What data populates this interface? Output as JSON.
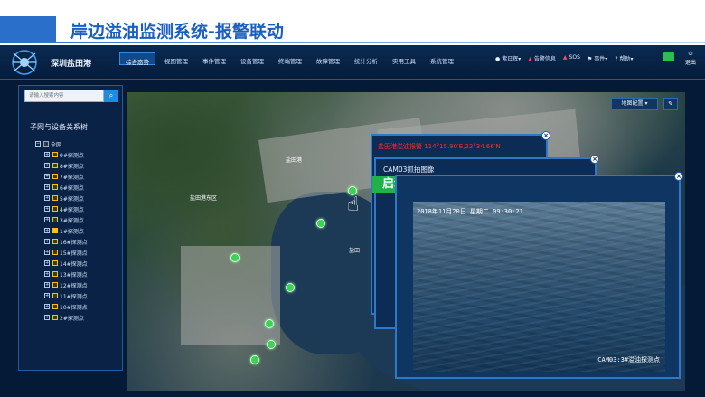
{
  "slide": {
    "title": "岸边溢油监测系统-报警联动"
  },
  "app": {
    "brand": "深圳盐田港",
    "nav_tabs": [
      {
        "label": "综合态势",
        "active": true
      },
      {
        "label": "视图管理",
        "active": false
      },
      {
        "label": "事件管理",
        "active": false
      },
      {
        "label": "设备管理",
        "active": false
      },
      {
        "label": "终端管理",
        "active": false
      },
      {
        "label": "故障管理",
        "active": false
      },
      {
        "label": "统计分析",
        "active": false
      },
      {
        "label": "实用工具",
        "active": false
      },
      {
        "label": "系统管理",
        "active": false
      }
    ],
    "right_tools": {
      "user": "紫日辉",
      "alerts": "告警信息",
      "sos": "SOS",
      "events": "事件",
      "help": "帮助",
      "exit": "退出"
    }
  },
  "sidebar": {
    "search_placeholder": "请输入搜索内容",
    "tree_title": "子网与设备关系树",
    "root": "全网",
    "nodes": [
      "9#探测点",
      "8#探测点",
      "7#探测点",
      "6#探测点",
      "5#探测点",
      "4#探测点",
      "3#探测点",
      "1#探测点",
      "16#探测点",
      "15#探测点",
      "14#探测点",
      "13#探测点",
      "12#探测点",
      "11#探测点",
      "10#探测点",
      "2#探测点"
    ]
  },
  "map": {
    "labels": {
      "yantian_port": "盐田港",
      "yantian_east": "盐田港东区",
      "yantian": "盐田"
    },
    "layer_btn": "地图配置",
    "pins_count": 12
  },
  "alarm_popup": {
    "text": "盐田港溢油报警 114°15.90′E,22°34.66′N"
  },
  "capture_popup": {
    "title": "CAM03抓拍图像",
    "start": "启动",
    "cancel": "取消"
  },
  "video": {
    "timestamp": "2018年11月20日 星期二 09:30:21",
    "camera": "CAM03:3#溢油探测点"
  }
}
